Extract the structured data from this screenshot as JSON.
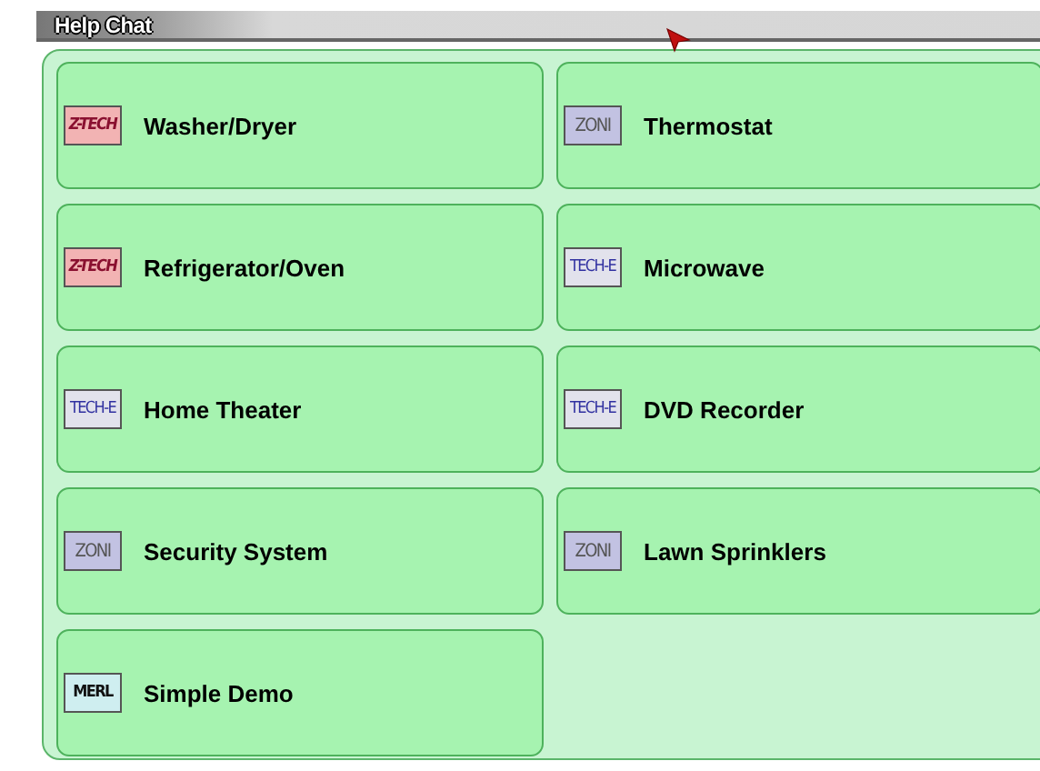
{
  "window": {
    "title": "Help Chat"
  },
  "devices": [
    {
      "label": "Washer/Dryer",
      "logo": "Z-TECH",
      "kind": "z-tech"
    },
    {
      "label": "Thermostat",
      "logo": "ZONI",
      "kind": "zoni"
    },
    {
      "label": "Refrigerator/Oven",
      "logo": "Z-TECH",
      "kind": "z-tech"
    },
    {
      "label": "Microwave",
      "logo": "TECH-E",
      "kind": "tech-e"
    },
    {
      "label": "Home Theater",
      "logo": "TECH-E",
      "kind": "tech-e"
    },
    {
      "label": "DVD Recorder",
      "logo": "TECH-E",
      "kind": "tech-e"
    },
    {
      "label": "Security System",
      "logo": "ZONI",
      "kind": "zoni"
    },
    {
      "label": "Lawn Sprinklers",
      "logo": "ZONI",
      "kind": "zoni"
    },
    {
      "label": "Simple Demo",
      "logo": "MERL",
      "kind": "merl"
    }
  ]
}
